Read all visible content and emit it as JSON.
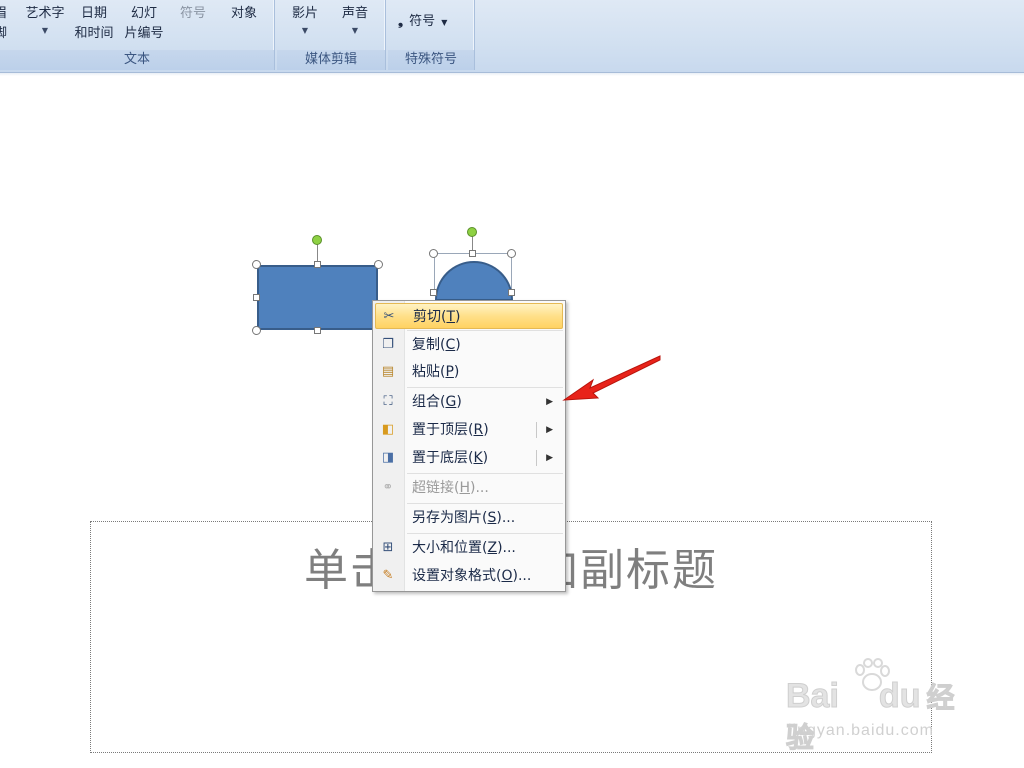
{
  "ribbon": {
    "text_group": {
      "label": "文本",
      "header_footer": {
        "line1": "眉",
        "line2": "脚"
      },
      "wordart": {
        "line1": "艺术字"
      },
      "datetime": {
        "line1": "日期",
        "line2": "和时间"
      },
      "slide_number": {
        "line1": "幻灯",
        "line2": "片编号"
      },
      "symbol": {
        "line1": "符号"
      },
      "object": {
        "line1": "对象"
      }
    },
    "media_group": {
      "label": "媒体剪辑",
      "movie": {
        "line1": "影片"
      },
      "sound": {
        "line1": "声音"
      }
    },
    "special_group": {
      "label": "特殊符号",
      "symbol": {
        "label": "符号"
      }
    }
  },
  "slide": {
    "subtitle_placeholder": "单击此处添加副标题"
  },
  "context_menu": {
    "items": [
      {
        "text": "剪切(",
        "key": "T",
        "tail": ")",
        "icon": "scissors-icon"
      },
      {
        "text": "复制(",
        "key": "C",
        "tail": ")",
        "icon": "copy-icon"
      },
      {
        "text": "粘贴(",
        "key": "P",
        "tail": ")",
        "icon": "paste-icon"
      },
      {
        "text": "组合(",
        "key": "G",
        "tail": ")",
        "icon": "group-icon"
      },
      {
        "text": "置于顶层(",
        "key": "R",
        "tail": ")",
        "icon": "bring-to-front-icon"
      },
      {
        "text": "置于底层(",
        "key": "K",
        "tail": ")",
        "icon": "send-to-back-icon"
      },
      {
        "text": "超链接(",
        "key": "H",
        "tail": ")...",
        "icon": "hyperlink-icon"
      },
      {
        "text": "另存为图片(",
        "key": "S",
        "tail": ")...",
        "icon": ""
      },
      {
        "text": "大小和位置(",
        "key": "Z",
        "tail": ")...",
        "icon": "size-position-icon"
      },
      {
        "text": "设置对象格式(",
        "key": "O",
        "tail": ")...",
        "icon": "format-object-icon"
      }
    ]
  },
  "watermark": {
    "brand": "Bai",
    "brand2": "du",
    "suffix": "经验",
    "url": "jingyan.baidu.com"
  },
  "colors": {
    "shape_fill": "#4f81bd",
    "shape_border": "#385d8a",
    "menu_highlight": "#ffe08a",
    "arrow": "#e8231a"
  }
}
